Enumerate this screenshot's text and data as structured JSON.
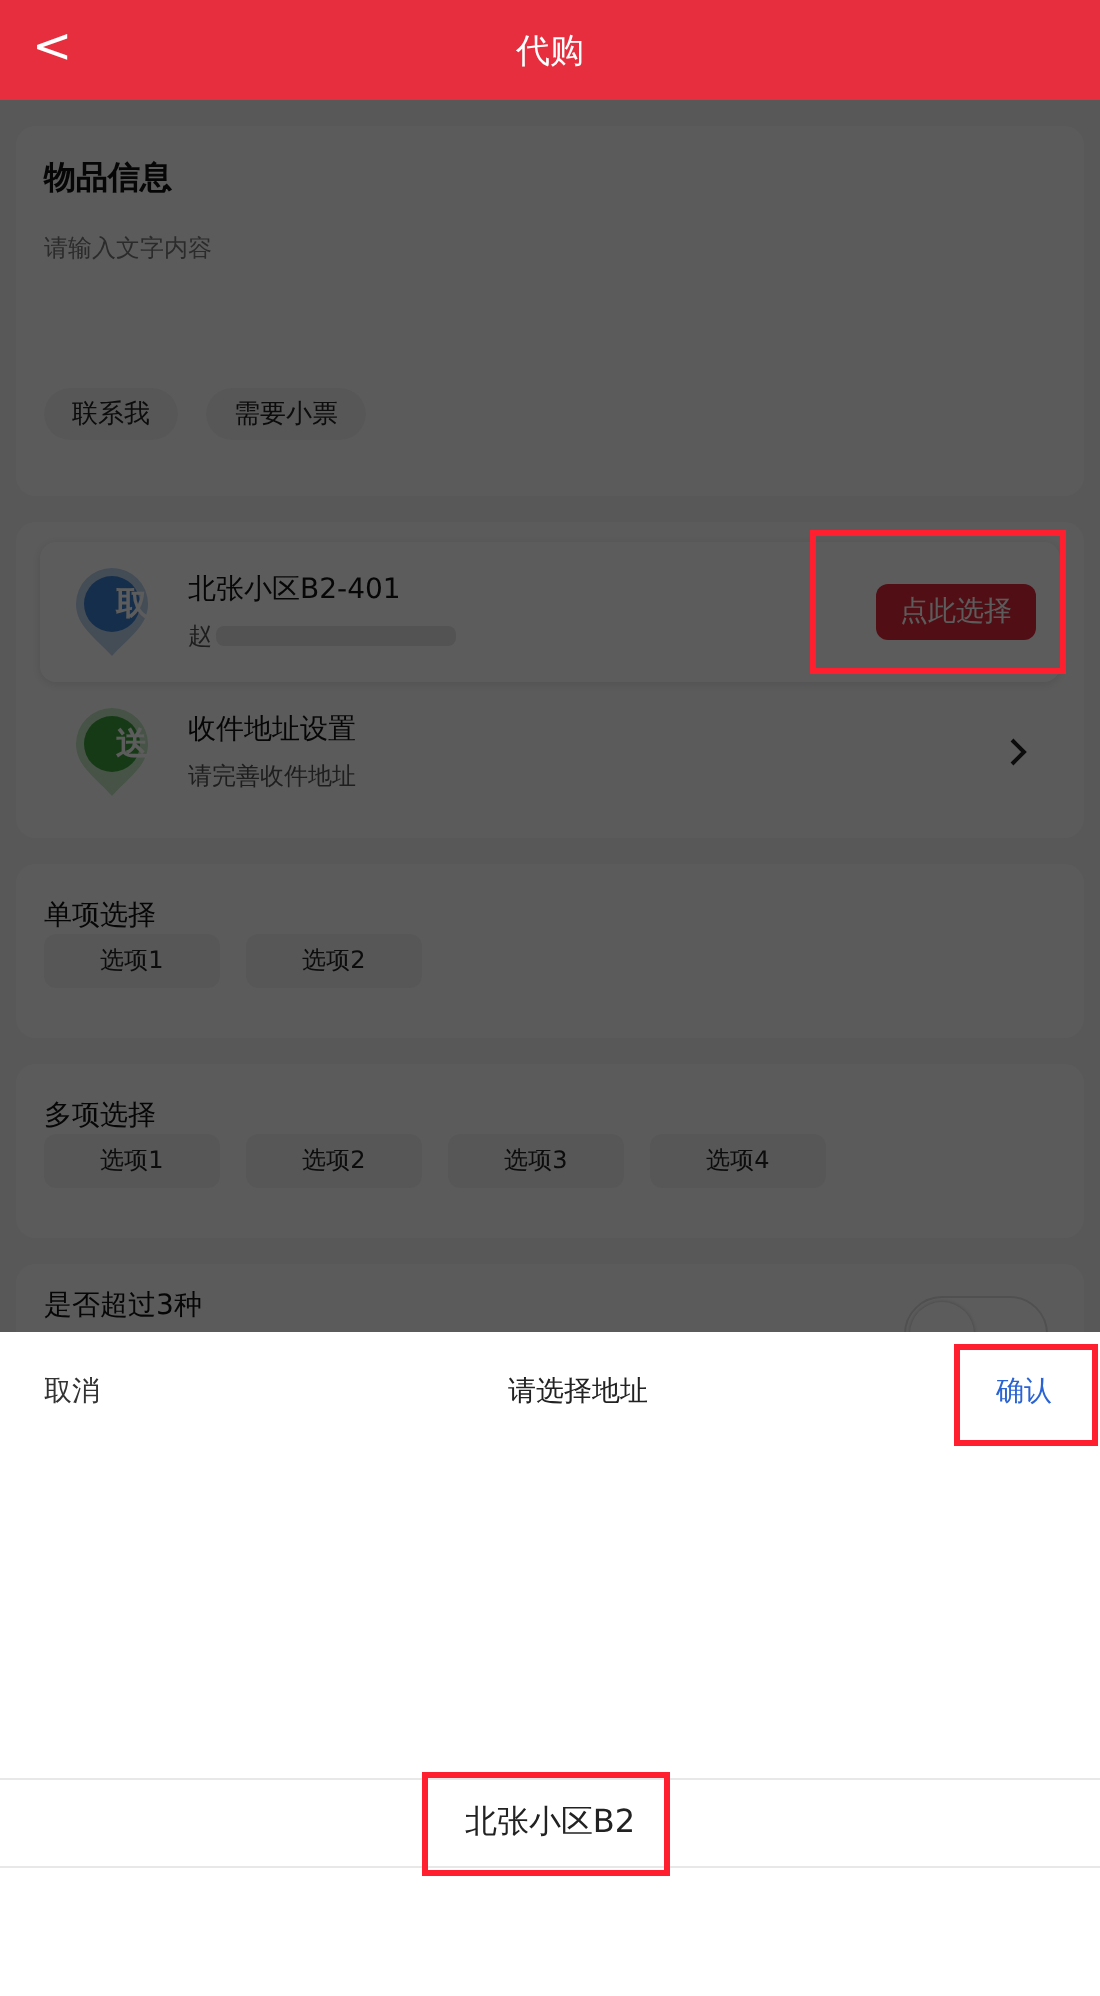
{
  "header": {
    "back": "<",
    "title": "代购"
  },
  "item_info": {
    "title": "物品信息",
    "placeholder": "请输入文字内容",
    "tags": [
      {
        "label": "联系我"
      },
      {
        "label": "需要小票"
      }
    ]
  },
  "pickup": {
    "badge": "取",
    "name": "北张小区B2-401",
    "contact": "赵",
    "button": {
      "label": "点此选择",
      "highlighted": true
    }
  },
  "delivery": {
    "badge": "送",
    "title": "收件地址设置",
    "hint": "请完善收件地址"
  },
  "single_choice": {
    "title": "单项选择",
    "options": [
      {
        "label": "选项1",
        "selected": false
      },
      {
        "label": "选项2",
        "selected": false
      }
    ]
  },
  "multi_choice": {
    "title": "多项选择",
    "options": [
      {
        "label": "选项1",
        "selected": false
      },
      {
        "label": "选项2",
        "selected": false
      },
      {
        "label": "选项3",
        "selected": false
      },
      {
        "label": "选项4",
        "selected": false
      }
    ]
  },
  "over_three": {
    "title": "是否超过3种",
    "on": false
  },
  "sheet": {
    "cancel": "取消",
    "title": "请选择地址",
    "confirm": {
      "label": "确认",
      "highlighted": true
    },
    "options": [
      {
        "label": "北张小区B2",
        "highlighted": true
      }
    ]
  }
}
